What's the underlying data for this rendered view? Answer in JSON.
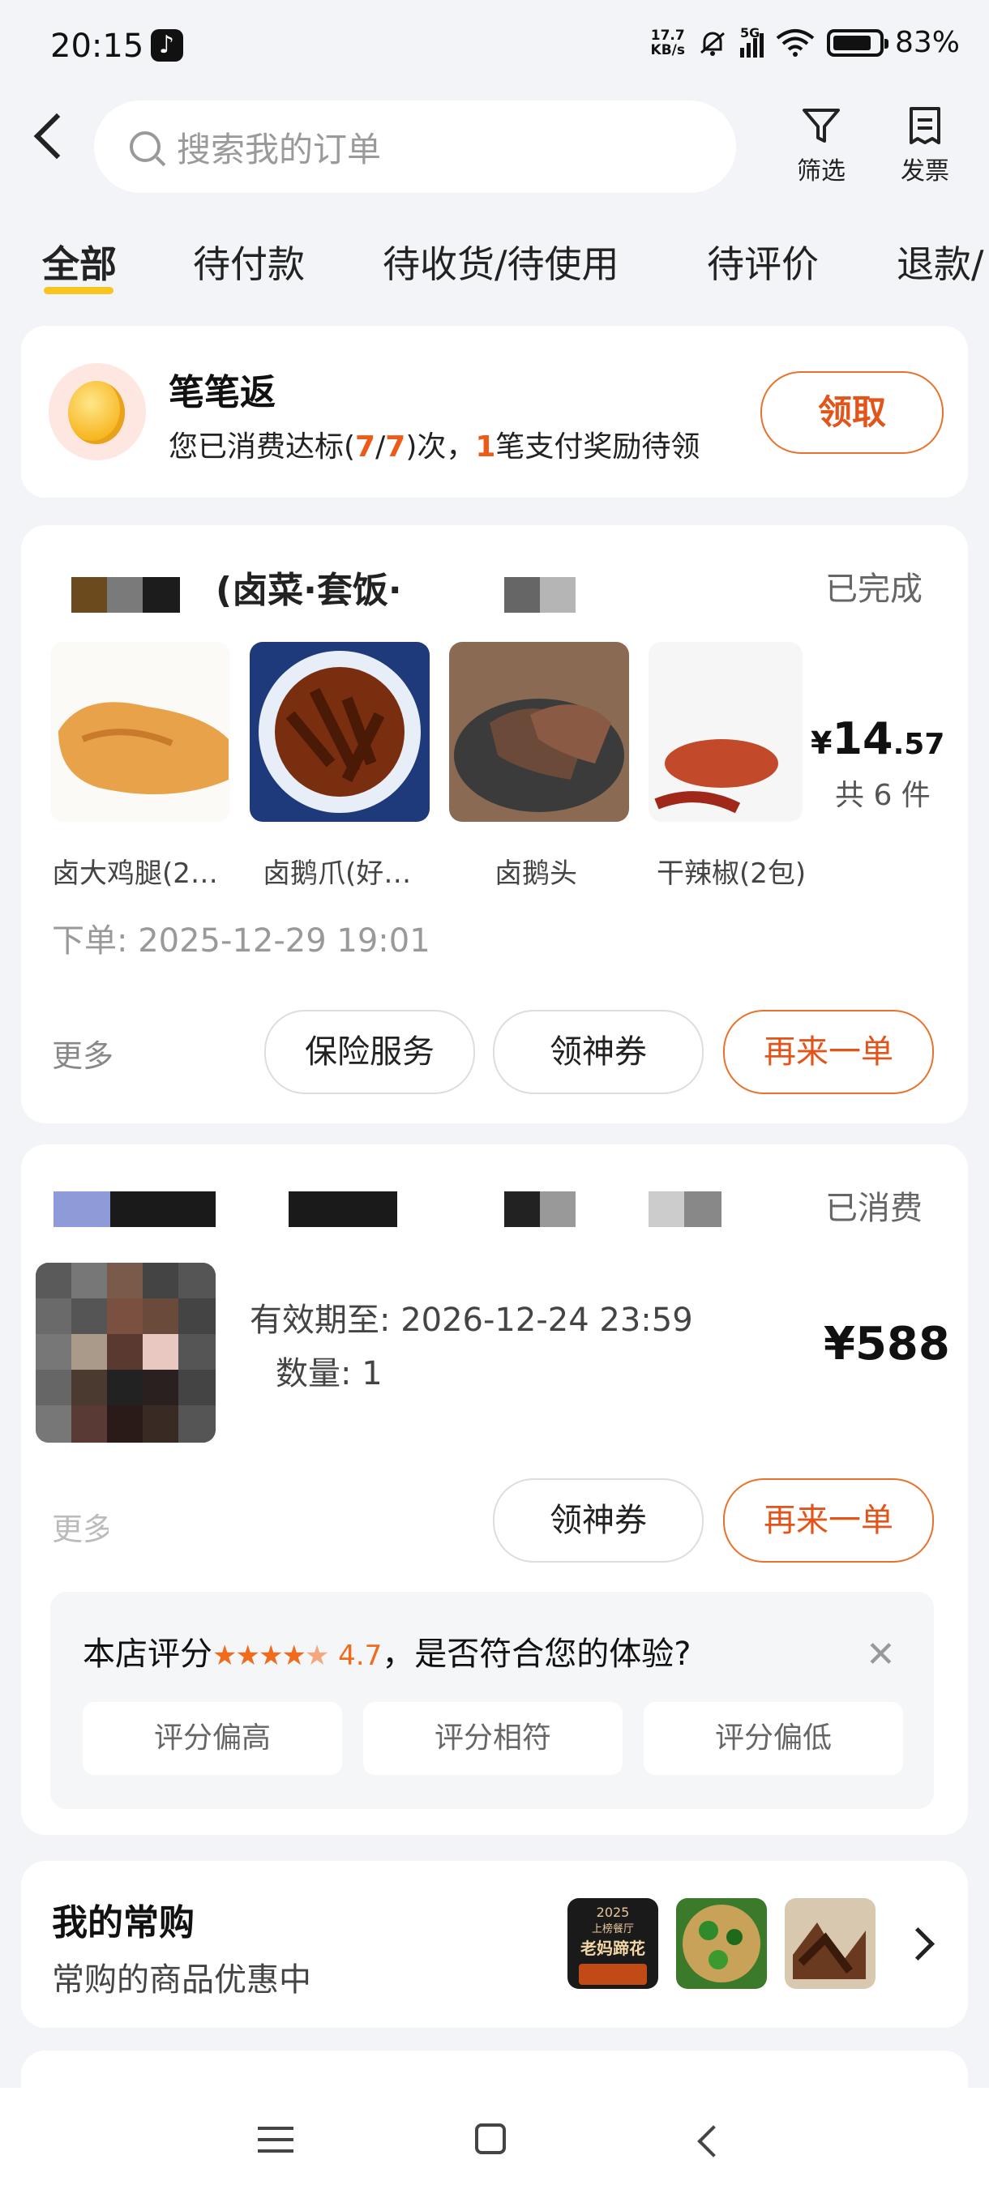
{
  "status_bar": {
    "time": "20:15",
    "net_speed_top": "17.7",
    "net_speed_bottom": "KB/s",
    "net_type": "5G",
    "battery": "83%"
  },
  "header": {
    "search_placeholder": "搜索我的订单",
    "filter_label": "筛选",
    "invoice_label": "发票"
  },
  "tabs": [
    {
      "label": "全部",
      "active": true
    },
    {
      "label": "待付款"
    },
    {
      "label": "待收货/待使用"
    },
    {
      "label": "待评价"
    },
    {
      "label": "退款/"
    }
  ],
  "promo": {
    "title": "笔笔返",
    "text_pre": "您已消费达标(",
    "done": "7",
    "sep": "/",
    "total": "7",
    "text_mid": ")次，",
    "pending": "1",
    "text_post": "笔支付奖励待领",
    "button": "领取"
  },
  "order1": {
    "shop_name_partial": "(卤菜·套饭·",
    "status": "已完成",
    "items": [
      "卤大鸡腿(2…",
      "卤鹅爪(好…",
      "卤鹅头",
      "干辣椒(2包)"
    ],
    "price_symbol": "¥",
    "price_int": "14",
    "price_dec": ".57",
    "count": "共 6 件",
    "order_time": "下单: 2025-12-29 19:01",
    "more": "更多",
    "buttons": {
      "insurance": "保险服务",
      "coupon": "领神券",
      "reorder": "再来一单"
    }
  },
  "order2": {
    "status": "已消费",
    "valid_until": "有效期至: 2026-12-24 23:59",
    "quantity": "数量: 1",
    "price": "¥588",
    "left_partial": "更多",
    "buttons": {
      "coupon": "领神券",
      "reorder": "再来一单"
    },
    "rating": {
      "title": "本店评分",
      "value": "4.7",
      "stars": 4.5,
      "question": "，是否符合您的体验?",
      "options": [
        "评分偏高",
        "评分相符",
        "评分偏低"
      ]
    }
  },
  "frequent": {
    "title": "我的常购",
    "subtitle": "常购的商品优惠中",
    "thumb1_year": "2025",
    "thumb1_line1": "上榜餐厅",
    "thumb1_line2": "老妈蹄花"
  },
  "colors": {
    "accent": "#ee5a17",
    "tab_underline": "#f7c51e",
    "background": "#f3f4f8"
  }
}
